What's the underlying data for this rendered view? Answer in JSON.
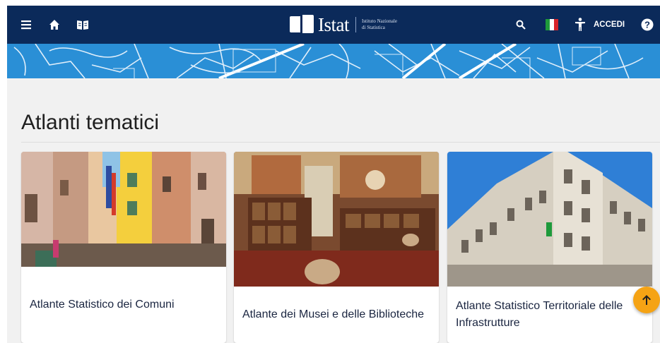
{
  "header": {
    "logo_text": "Istat",
    "logo_subtitle_line1": "Istituto Nazionale",
    "logo_subtitle_line2": "di Statistica",
    "login_label": "ACCEDI",
    "icons": [
      "menu-icon",
      "home-icon",
      "book-icon",
      "search-icon",
      "italian-flag-icon",
      "accessibility-icon",
      "help-icon"
    ]
  },
  "page": {
    "title": "Atlanti tematici"
  },
  "cards": [
    {
      "title": "Atlante Statistico dei Comuni"
    },
    {
      "title": "Atlante dei Musei e delle Biblioteche"
    },
    {
      "title": "Atlante Statistico Territoriale delle Infrastrutture"
    }
  ],
  "colors": {
    "header_bg": "#0b2a5a",
    "banner_bg": "#2a8fd6",
    "fab_bg": "#f5a314",
    "card_text": "#1a2540"
  }
}
